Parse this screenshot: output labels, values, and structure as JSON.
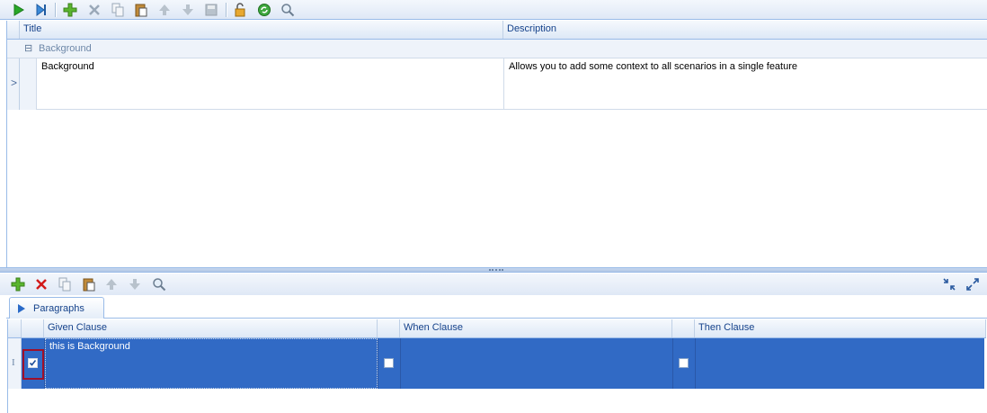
{
  "top_toolbar": {
    "icons": [
      "play-icon",
      "step-icon",
      "add-icon",
      "delete-icon",
      "copy-icon",
      "paste-icon",
      "move-up-icon",
      "move-down-icon",
      "save-icon",
      "lock-icon",
      "refresh-icon",
      "search-icon"
    ]
  },
  "top_grid": {
    "columns": [
      "Title",
      "Description"
    ],
    "group_label": "Background",
    "group_toggle": "⊟",
    "row": {
      "title": "Background",
      "description": "Allows you to add some context to all scenarios in a single feature",
      "indicator": ">"
    }
  },
  "bottom_toolbar": {
    "icons": [
      "add-icon",
      "delete-icon",
      "copy-icon",
      "paste-icon",
      "move-up-icon",
      "move-down-icon",
      "search-icon"
    ],
    "right_icons": [
      "collapse-icon",
      "expand-icon"
    ]
  },
  "tabs": [
    {
      "label": "Paragraphs"
    }
  ],
  "bottom_grid": {
    "columns": [
      "Given Clause",
      "When Clause",
      "Then Clause"
    ],
    "row": {
      "given": "this is Background",
      "when": "",
      "then": "",
      "indicator": "I",
      "given_checked": true
    }
  },
  "colors": {
    "accent": "#316ac5",
    "border": "#99bbe8",
    "header_text": "#15428b",
    "focus_box": "#a0102a"
  }
}
